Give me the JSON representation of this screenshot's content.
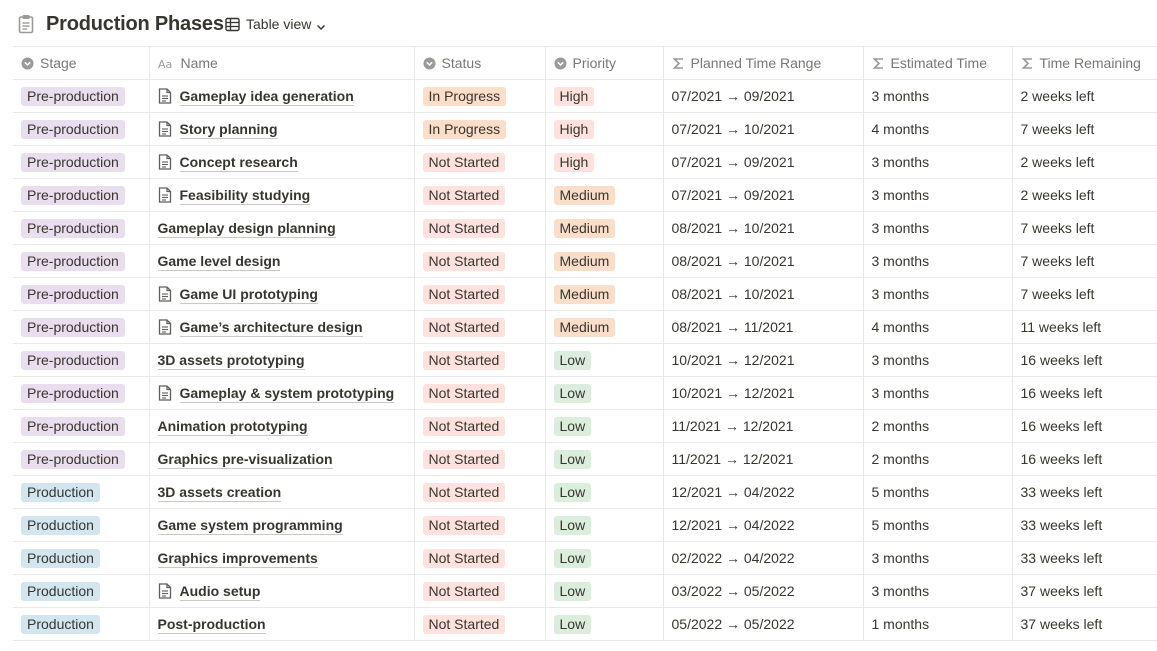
{
  "page": {
    "title": "Production Phases",
    "view_label": "Table view",
    "icons": {
      "page": "clipboard-icon",
      "view": "table-icon",
      "dropdown": "chevron-down-icon"
    }
  },
  "colors": {
    "pre_production": "#e8deee",
    "production": "#d3e5ef",
    "in_progress": "#fadec9",
    "not_started": "#ffe2dd",
    "high": "#ffe2dd",
    "medium": "#fadec9",
    "low": "#dbeddb"
  },
  "columns": [
    {
      "key": "stage",
      "label": "Stage",
      "icon": "select-icon"
    },
    {
      "key": "name",
      "label": "Name",
      "icon": "title-icon"
    },
    {
      "key": "status",
      "label": "Status",
      "icon": "select-icon"
    },
    {
      "key": "priority",
      "label": "Priority",
      "icon": "select-icon"
    },
    {
      "key": "planned",
      "label": "Planned Time Range",
      "icon": "formula-icon"
    },
    {
      "key": "estimated",
      "label": "Estimated Time",
      "icon": "formula-icon"
    },
    {
      "key": "remaining",
      "label": "Time Remaining",
      "icon": "formula-icon"
    }
  ],
  "rows": [
    {
      "stage": "Pre-production",
      "name": "Gameplay idea generation",
      "has_doc": true,
      "status": "In Progress",
      "priority": "High",
      "planned": "07/2021 → 09/2021",
      "estimated": "3 months",
      "remaining": "2 weeks left"
    },
    {
      "stage": "Pre-production",
      "name": "Story planning",
      "has_doc": true,
      "status": "In Progress",
      "priority": "High",
      "planned": "07/2021 → 10/2021",
      "estimated": "4 months",
      "remaining": "7 weeks left"
    },
    {
      "stage": "Pre-production",
      "name": "Concept research",
      "has_doc": true,
      "status": "Not Started",
      "priority": "High",
      "planned": "07/2021 → 09/2021",
      "estimated": "3 months",
      "remaining": "2 weeks left"
    },
    {
      "stage": "Pre-production",
      "name": "Feasibility studying",
      "has_doc": true,
      "status": "Not Started",
      "priority": "Medium",
      "planned": "07/2021 → 09/2021",
      "estimated": "3 months",
      "remaining": "2 weeks left"
    },
    {
      "stage": "Pre-production",
      "name": "Gameplay design planning",
      "has_doc": false,
      "status": "Not Started",
      "priority": "Medium",
      "planned": "08/2021 → 10/2021",
      "estimated": "3 months",
      "remaining": "7 weeks left"
    },
    {
      "stage": "Pre-production",
      "name": "Game level design",
      "has_doc": false,
      "status": "Not Started",
      "priority": "Medium",
      "planned": "08/2021 → 10/2021",
      "estimated": "3 months",
      "remaining": "7 weeks left"
    },
    {
      "stage": "Pre-production",
      "name": "Game UI prototyping",
      "has_doc": true,
      "status": "Not Started",
      "priority": "Medium",
      "planned": "08/2021 → 10/2021",
      "estimated": "3 months",
      "remaining": "7 weeks left"
    },
    {
      "stage": "Pre-production",
      "name": "Game’s architecture design",
      "has_doc": true,
      "status": "Not Started",
      "priority": "Medium",
      "planned": "08/2021 → 11/2021",
      "estimated": "4 months",
      "remaining": "11 weeks left"
    },
    {
      "stage": "Pre-production",
      "name": "3D assets prototyping",
      "has_doc": false,
      "status": "Not Started",
      "priority": "Low",
      "planned": "10/2021 → 12/2021",
      "estimated": "3 months",
      "remaining": "16 weeks left"
    },
    {
      "stage": "Pre-production",
      "name": "Gameplay & system prototyping",
      "has_doc": true,
      "status": "Not Started",
      "priority": "Low",
      "planned": "10/2021 → 12/2021",
      "estimated": "3 months",
      "remaining": "16 weeks left"
    },
    {
      "stage": "Pre-production",
      "name": "Animation prototyping",
      "has_doc": false,
      "status": "Not Started",
      "priority": "Low",
      "planned": "11/2021 → 12/2021",
      "estimated": "2 months",
      "remaining": "16 weeks left"
    },
    {
      "stage": "Pre-production",
      "name": "Graphics pre-visualization",
      "has_doc": false,
      "status": "Not Started",
      "priority": "Low",
      "planned": "11/2021 → 12/2021",
      "estimated": "2 months",
      "remaining": "16 weeks left"
    },
    {
      "stage": "Production",
      "name": "3D assets creation",
      "has_doc": false,
      "status": "Not Started",
      "priority": "Low",
      "planned": "12/2021 → 04/2022",
      "estimated": "5 months",
      "remaining": "33 weeks left"
    },
    {
      "stage": "Production",
      "name": "Game system programming",
      "has_doc": false,
      "status": "Not Started",
      "priority": "Low",
      "planned": "12/2021 → 04/2022",
      "estimated": "5 months",
      "remaining": "33 weeks left"
    },
    {
      "stage": "Production",
      "name": "Graphics improvements",
      "has_doc": false,
      "status": "Not Started",
      "priority": "Low",
      "planned": "02/2022 → 04/2022",
      "estimated": "3 months",
      "remaining": "33 weeks left"
    },
    {
      "stage": "Production",
      "name": "Audio setup",
      "has_doc": true,
      "status": "Not Started",
      "priority": "Low",
      "planned": "03/2022 → 05/2022",
      "estimated": "3 months",
      "remaining": "37 weeks left"
    },
    {
      "stage": "Production",
      "name": "Post-production",
      "has_doc": false,
      "status": "Not Started",
      "priority": "Low",
      "planned": "05/2022 → 05/2022",
      "estimated": "1 months",
      "remaining": "37 weeks left"
    }
  ]
}
